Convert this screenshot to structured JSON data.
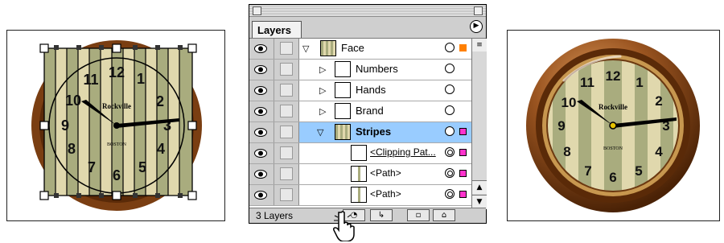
{
  "palette": {
    "title": "Layers",
    "menu_icon": "triangle-right-icon",
    "layer_count": "3 Layers",
    "rows": [
      {
        "name": "Face",
        "expanded": true,
        "swatch": "#ff8000"
      },
      {
        "name": "Numbers",
        "expanded": false
      },
      {
        "name": "Hands",
        "expanded": false
      },
      {
        "name": "Brand",
        "expanded": false
      },
      {
        "name": "Stripes",
        "expanded": true,
        "selected": true,
        "swatch": "#ff33cc"
      },
      {
        "name": "<Clipping Pat...",
        "swatch": "#ff33cc"
      },
      {
        "name": "<Path>",
        "swatch": "#ff33cc"
      },
      {
        "name": "<Path>",
        "swatch": "#ff33cc"
      }
    ],
    "bottom_buttons": [
      "make-clipping-mask",
      "create-sublayer",
      "new-layer",
      "trash"
    ]
  },
  "clock": {
    "brand": "Rockville",
    "city": "BOSTON",
    "numerals": [
      "12",
      "1",
      "2",
      "3",
      "4",
      "5",
      "6",
      "7",
      "8",
      "9",
      "10",
      "11"
    ]
  },
  "colors": {
    "selection": "#99ccff",
    "swatch_orange": "#ff8000",
    "swatch_magenta": "#ff33cc",
    "stripe_dark": "#a9ac7e",
    "stripe_light": "#e0d8ad",
    "rim": "#7a3e12"
  }
}
